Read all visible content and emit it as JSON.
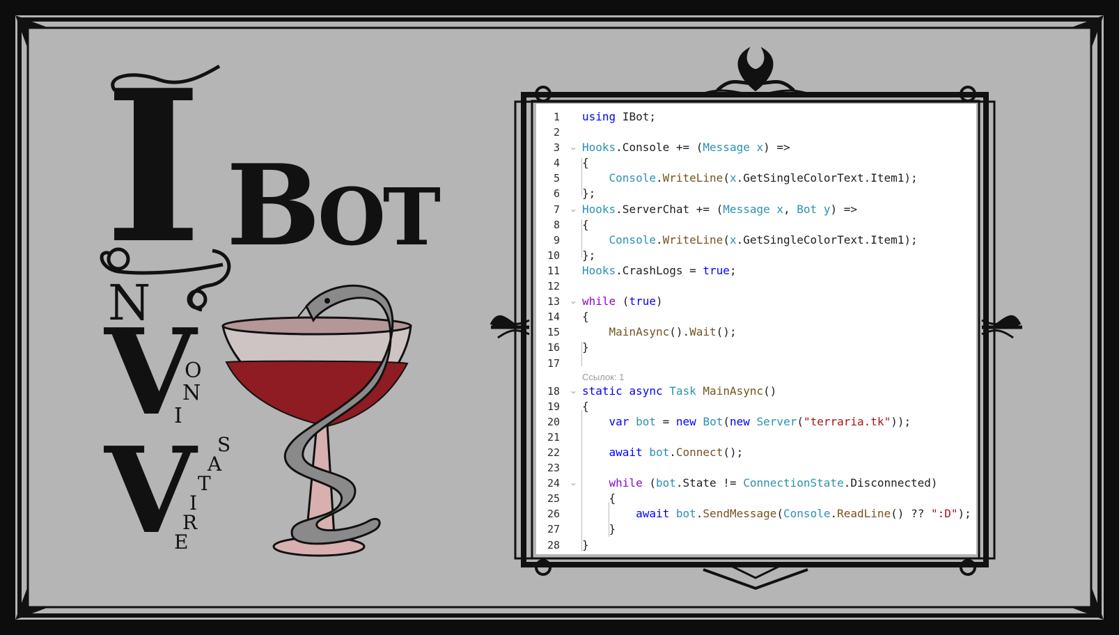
{
  "logo": {
    "letter_i": "I",
    "word_bot": "Bot",
    "letter_n": "N",
    "letter_v1": "V",
    "letters_oni": [
      "O",
      "N",
      "I"
    ],
    "letter_v2": "V",
    "letters_satire": [
      "S",
      "A",
      "T",
      "I",
      "R",
      "E"
    ]
  },
  "code": {
    "lens_text": "Ссылок: 1",
    "lines": [
      {
        "n": "1",
        "html": "<span class=\"kw\">using</span> IBot;",
        "fold": ""
      },
      {
        "n": "2",
        "html": "",
        "fold": ""
      },
      {
        "n": "3",
        "html": "<span class=\"ty\">Hooks</span>.Console += (<span class=\"ty\">Message</span> <span class=\"ty\">x</span>) =>",
        "fold": "⌵"
      },
      {
        "n": "4",
        "html": "{",
        "fold": ""
      },
      {
        "n": "5",
        "html": "    <span class=\"ty\">Console</span>.<span class=\"fn\">WriteLine</span>(<span class=\"ty\">x</span>.GetSingleColorText.Item1);",
        "fold": ""
      },
      {
        "n": "6",
        "html": "};",
        "fold": ""
      },
      {
        "n": "7",
        "html": "<span class=\"ty\">Hooks</span>.ServerChat += (<span class=\"ty\">Message</span> <span class=\"ty\">x</span>, <span class=\"ty\">Bot</span> <span class=\"ty\">y</span>) =>",
        "fold": "⌵"
      },
      {
        "n": "8",
        "html": "{",
        "fold": ""
      },
      {
        "n": "9",
        "html": "    <span class=\"ty\">Console</span>.<span class=\"fn\">WriteLine</span>(<span class=\"ty\">x</span>.GetSingleColorText.Item1);",
        "fold": ""
      },
      {
        "n": "10",
        "html": "};",
        "fold": ""
      },
      {
        "n": "11",
        "html": "<span class=\"ty\">Hooks</span>.CrashLogs = <span class=\"kw\">true</span>;",
        "fold": ""
      },
      {
        "n": "12",
        "html": "",
        "fold": ""
      },
      {
        "n": "13",
        "html": "<span class=\"ctl\">while</span> (<span class=\"kw\">true</span>)",
        "fold": "⌵"
      },
      {
        "n": "14",
        "html": "{",
        "fold": ""
      },
      {
        "n": "15",
        "html": "    <span class=\"fn\">MainAsync</span>().<span class=\"fn\">Wait</span>();",
        "fold": ""
      },
      {
        "n": "16",
        "html": "}",
        "fold": ""
      },
      {
        "n": "17",
        "html": "",
        "fold": ""
      },
      {
        "lens": true
      },
      {
        "n": "18",
        "html": "<span class=\"kw\">static</span> <span class=\"kw\">async</span> <span class=\"ty\">Task</span> <span class=\"fn\">MainAsync</span>()",
        "fold": "⌵"
      },
      {
        "n": "19",
        "html": "{",
        "fold": ""
      },
      {
        "n": "20",
        "html": "    <span class=\"kw\">var</span> <span class=\"ty\">bot</span> = <span class=\"kw\">new</span> <span class=\"ty\">Bot</span>(<span class=\"kw\">new</span> <span class=\"ty\">Server</span>(<span class=\"str\">\"terraria.tk\"</span>));",
        "fold": ""
      },
      {
        "n": "21",
        "html": "",
        "fold": ""
      },
      {
        "n": "22",
        "html": "    <span class=\"kw\">await</span> <span class=\"ty\">bot</span>.<span class=\"fn\">Connect</span>();",
        "fold": ""
      },
      {
        "n": "23",
        "html": "",
        "fold": ""
      },
      {
        "n": "24",
        "html": "    <span class=\"ctl\">while</span> (<span class=\"ty\">bot</span>.State != <span class=\"ty\">ConnectionState</span>.Disconnected)",
        "fold": "⌵"
      },
      {
        "n": "25",
        "html": "    {",
        "fold": ""
      },
      {
        "n": "26",
        "html": "        <span class=\"kw\">await</span> <span class=\"ty\">bot</span>.<span class=\"fn\">SendMessage</span>(<span class=\"ty\">Console</span>.<span class=\"fn\">ReadLine</span>() ?? <span class=\"str\">\":D\"</span>);",
        "fold": ""
      },
      {
        "n": "27",
        "html": "    }",
        "fold": ""
      },
      {
        "n": "28",
        "html": "}",
        "fold": ""
      }
    ]
  }
}
